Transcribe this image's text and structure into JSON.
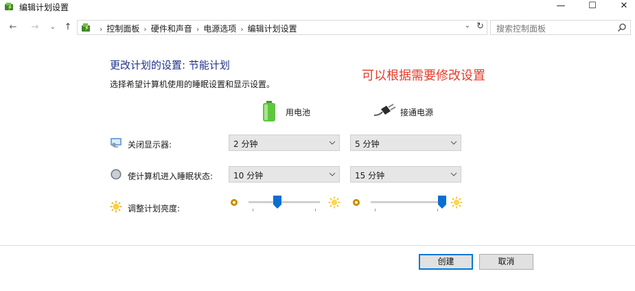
{
  "window": {
    "title": "编辑计划设置",
    "minimize_glyph": "—",
    "maximize_glyph": "☐",
    "close_glyph": "✕"
  },
  "nav": {
    "back_glyph": "←",
    "forward_glyph": "→",
    "recent_glyph": "⌄",
    "up_glyph": "↑",
    "breadcrumbs": [
      "控制面板",
      "硬件和声音",
      "电源选项",
      "编辑计划设置"
    ],
    "search_placeholder": "搜索控制面板"
  },
  "page": {
    "heading": "更改计划的设置: 节能计划",
    "subheading": "选择希望计算机使用的睡眠设置和显示设置。",
    "annotation": "可以根据需要修改设置"
  },
  "columns": {
    "battery": "用电池",
    "plugged_in": "接通电源"
  },
  "settings": {
    "display_off": {
      "label": "关闭显示器:",
      "battery": "2 分钟",
      "plugged_in": "5 分钟"
    },
    "sleep": {
      "label": "使计算机进入睡眠状态:",
      "battery": "10 分钟",
      "plugged_in": "15 分钟"
    },
    "brightness": {
      "label": "调整计划亮度:",
      "battery_level": 0.4,
      "plugged_in_level": 1.0
    }
  },
  "buttons": {
    "create": "创建",
    "cancel": "取消"
  },
  "colors": {
    "heading": "#1e3287",
    "annotation": "#e53a2a",
    "accent": "#0078d7"
  },
  "icons": [
    "power-plan-icon",
    "battery-icon",
    "power-plug-icon",
    "display-icon",
    "sleep-moon-icon",
    "brightness-icon",
    "search-icon",
    "refresh-icon"
  ]
}
